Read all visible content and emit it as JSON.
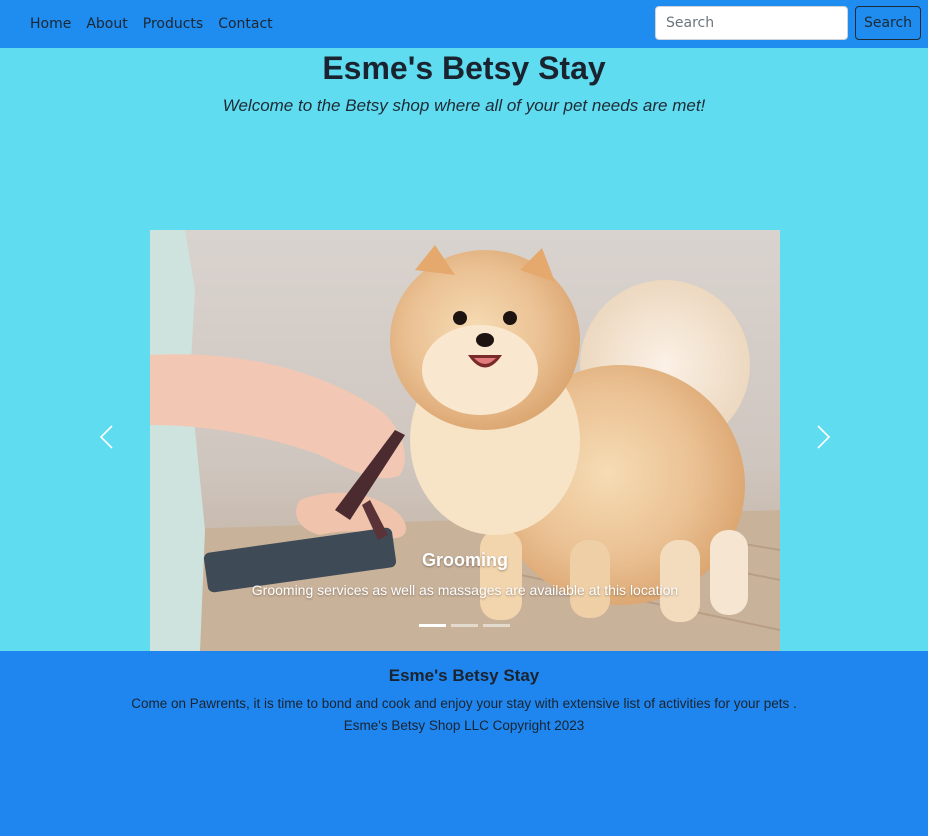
{
  "nav": {
    "links": [
      "Home",
      "About",
      "Products",
      "Contact"
    ],
    "search_placeholder": "Search",
    "search_button": "Search"
  },
  "hero": {
    "title": "Esme's Betsy Stay",
    "subtitle": "Welcome to the Betsy shop where all of your pet needs are met!"
  },
  "carousel": {
    "active_index": 0,
    "slide_count": 3,
    "slide": {
      "image": "pomeranian-grooming-photo",
      "caption_title": "Grooming",
      "caption_text": "Grooming services as well as massages are available at this location"
    },
    "prev_icon": "chevron-left-icon",
    "next_icon": "chevron-right-icon"
  },
  "footer": {
    "title": "Esme's Betsy Stay",
    "text": "Come on Pawrents, it is time to bond and cook and enjoy your stay with extensive list of activities for your pets .",
    "copyright": "Esme's Betsy Shop LLC Copyright 2023"
  },
  "colors": {
    "navbar": "#1f8cf0",
    "main_bg": "#5fdcf0",
    "footer_bg": "#1f86f0"
  }
}
